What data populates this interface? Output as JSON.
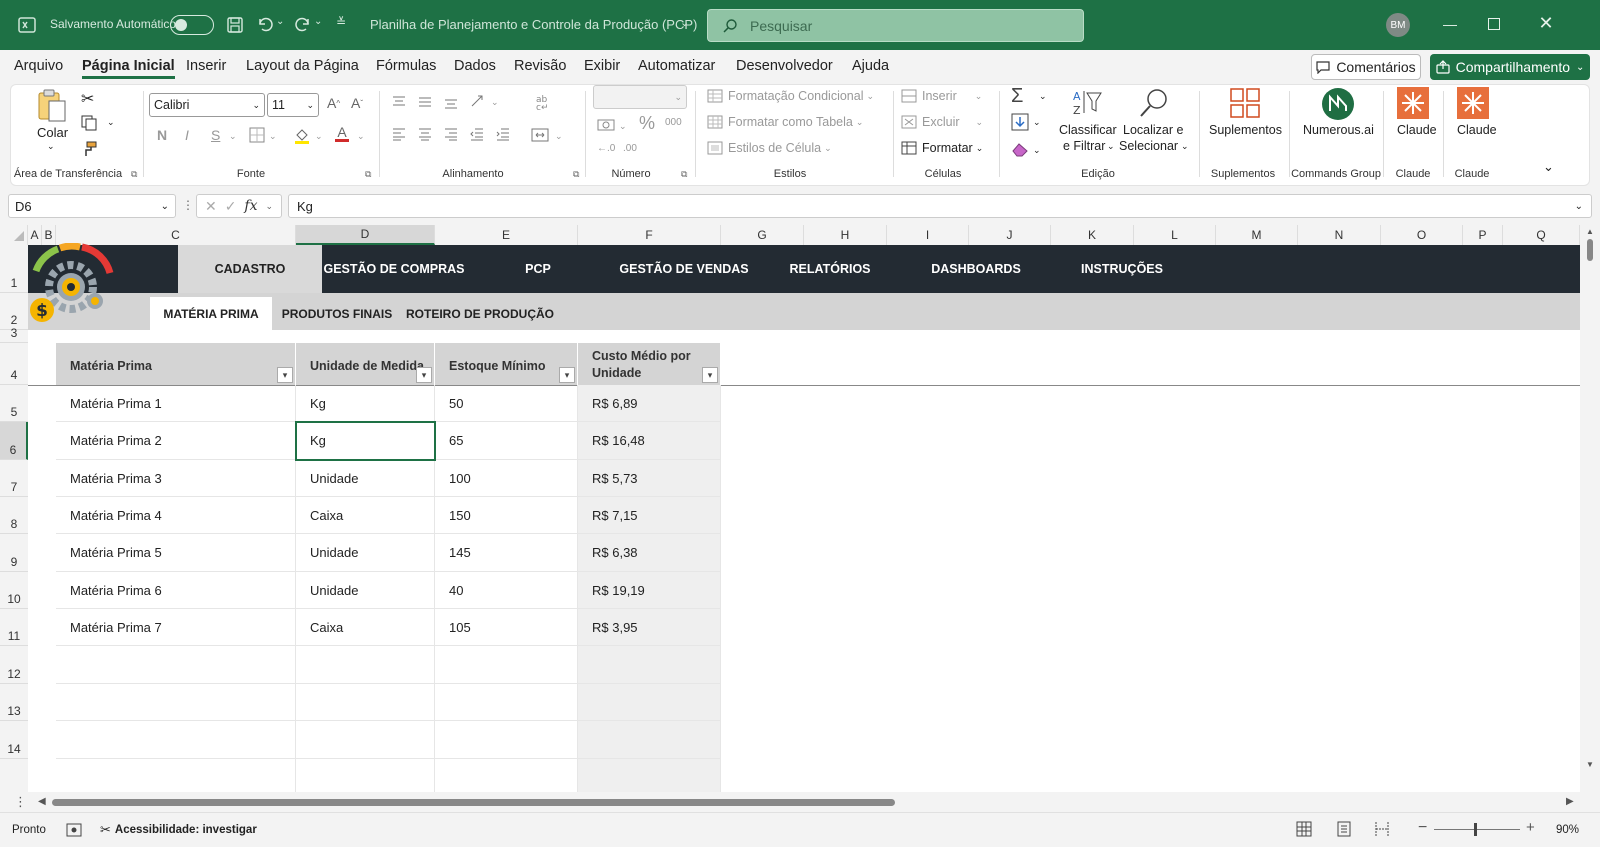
{
  "titlebar": {
    "autosave_label": "Salvamento Automático",
    "file_name": "Planilha de Planejamento e Controle da Produção (PCP)",
    "search_placeholder": "Pesquisar",
    "avatar_initials": "BM",
    "accent": "#1e7145"
  },
  "ribbon_tabs": [
    "Arquivo",
    "Página Inicial",
    "Inserir",
    "Layout da Página",
    "Fórmulas",
    "Dados",
    "Revisão",
    "Exibir",
    "Automatizar",
    "Desenvolvedor",
    "Ajuda"
  ],
  "ribbon_buttons": {
    "comments": "Comentários",
    "share": "Compartilhamento"
  },
  "ribbon": {
    "clipboard": {
      "paste": "Colar",
      "label": "Área de Transferência"
    },
    "font": {
      "name": "Calibri",
      "size": "11",
      "label": "Fonte",
      "bold": "N",
      "italic": "I",
      "underline": "S"
    },
    "alignment": {
      "label": "Alinhamento"
    },
    "number": {
      "label": "Número",
      "percent": "%",
      "thousands": "000"
    },
    "styles": {
      "conditional": "Formatação Condicional",
      "as_table": "Formatar como Tabela",
      "cell_styles": "Estilos de Célula",
      "label": "Estilos"
    },
    "cells": {
      "insert": "Inserir",
      "delete": "Excluir",
      "format": "Formatar",
      "label": "Células"
    },
    "editing": {
      "sort_1": "Classificar",
      "sort_2": "e Filtrar",
      "find_1": "Localizar e",
      "find_2": "Selecionar",
      "label": "Edição"
    },
    "addins": {
      "button": "Suplementos",
      "label": "Suplementos"
    },
    "numerous": {
      "button": "Numerous.ai",
      "label": "Commands Group"
    },
    "claude1": {
      "button": "Claude",
      "label": "Claude"
    },
    "claude2": {
      "button": "Claude",
      "label": "Claude"
    }
  },
  "formula_bar": {
    "name_box": "D6",
    "fx": "fx",
    "content": "Kg"
  },
  "columns": [
    "A",
    "B",
    "C",
    "D",
    "E",
    "F",
    "G",
    "H",
    "I",
    "J",
    "K",
    "L",
    "M",
    "N",
    "O",
    "P",
    "Q"
  ],
  "rows": [
    "1",
    "2",
    "3",
    "4",
    "5",
    "6",
    "7",
    "8",
    "9",
    "10",
    "11",
    "12",
    "13",
    "14"
  ],
  "nav_tabs": [
    "CADASTRO",
    "GESTÃO DE COMPRAS",
    "PCP",
    "GESTÃO DE VENDAS",
    "RELATÓRIOS",
    "DASHBOARDS",
    "INSTRUÇÕES"
  ],
  "sub_tabs": [
    "MATÉRIA PRIMA",
    "PRODUTOS FINAIS",
    "ROTEIRO DE PRODUÇÃO"
  ],
  "logo_symbol": "$",
  "table": {
    "headers": [
      "Matéria Prima",
      "Unidade de Medida",
      "Estoque Mínimo",
      "Custo Médio por Unidade"
    ],
    "rows": [
      [
        "Matéria Prima 1",
        "Kg",
        "50",
        "R$ 6,89"
      ],
      [
        "Matéria Prima 2",
        "Kg",
        "65",
        "R$ 16,48"
      ],
      [
        "Matéria Prima 3",
        "Unidade",
        "100",
        "R$ 5,73"
      ],
      [
        "Matéria Prima 4",
        "Caixa",
        "150",
        "R$ 7,15"
      ],
      [
        "Matéria Prima 5",
        "Unidade",
        "145",
        "R$ 6,38"
      ],
      [
        "Matéria Prima 6",
        "Unidade",
        "40",
        "R$ 19,19"
      ],
      [
        "Matéria Prima 7",
        "Caixa",
        "105",
        "R$ 3,95"
      ]
    ]
  },
  "status": {
    "ready": "Pronto",
    "accessibility": "Acessibilidade: investigar",
    "zoom": "90%"
  }
}
